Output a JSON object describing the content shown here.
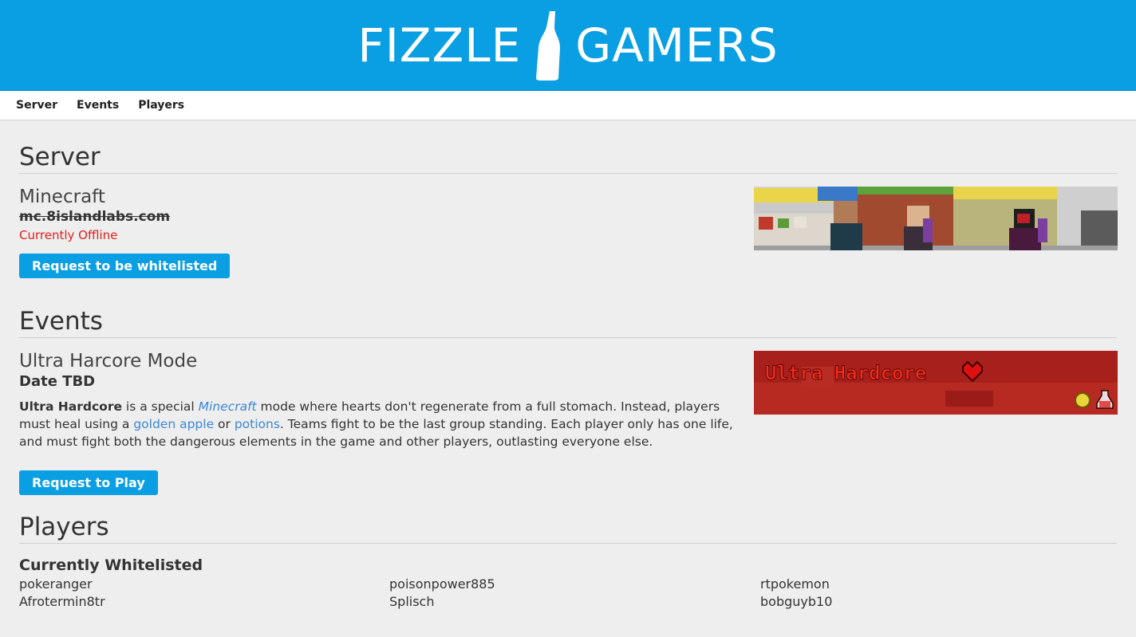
{
  "header": {
    "brand_left": "FIZZLE",
    "brand_right": "GAMERS"
  },
  "nav": {
    "items": [
      "Server",
      "Events",
      "Players"
    ]
  },
  "server": {
    "section_title": "Server",
    "game": "Minecraft",
    "host": "mc.8islandlabs.com",
    "status": "Currently Offline",
    "button": "Request to be whitelisted"
  },
  "events": {
    "section_title": "Events",
    "mode": "Ultra Harcore Mode",
    "date": "Date TBD",
    "desc": {
      "bold": "Ultra Hardcore",
      "t1": " is a special ",
      "minecraft": "Minecraft",
      "t2": " mode where hearts don't regenerate from a full stomach. Instead, players must heal using a ",
      "golden_apple": "golden apple",
      "t3": " or ",
      "potions": "potions",
      "t4": ". Teams fight to be the last group standing. Each player only has one life, and must fight both the dangerous elements in the game and other players, outlasting everyone else."
    },
    "button": "Request to Play",
    "banner_text": "Ultra Hardcore"
  },
  "players": {
    "section_title": "Players",
    "whitelist_title": "Currently Whitelisted",
    "col1": [
      "pokeranger",
      "Afrotermin8tr"
    ],
    "col2": [
      "poisonpower885",
      "Splisch"
    ],
    "col3": [
      "rtpokemon",
      "bobguyb10"
    ]
  },
  "colors": {
    "brand_blue": "#0a9ee3",
    "offline_red": "#e0201b",
    "link_blue": "#3b87d7"
  }
}
